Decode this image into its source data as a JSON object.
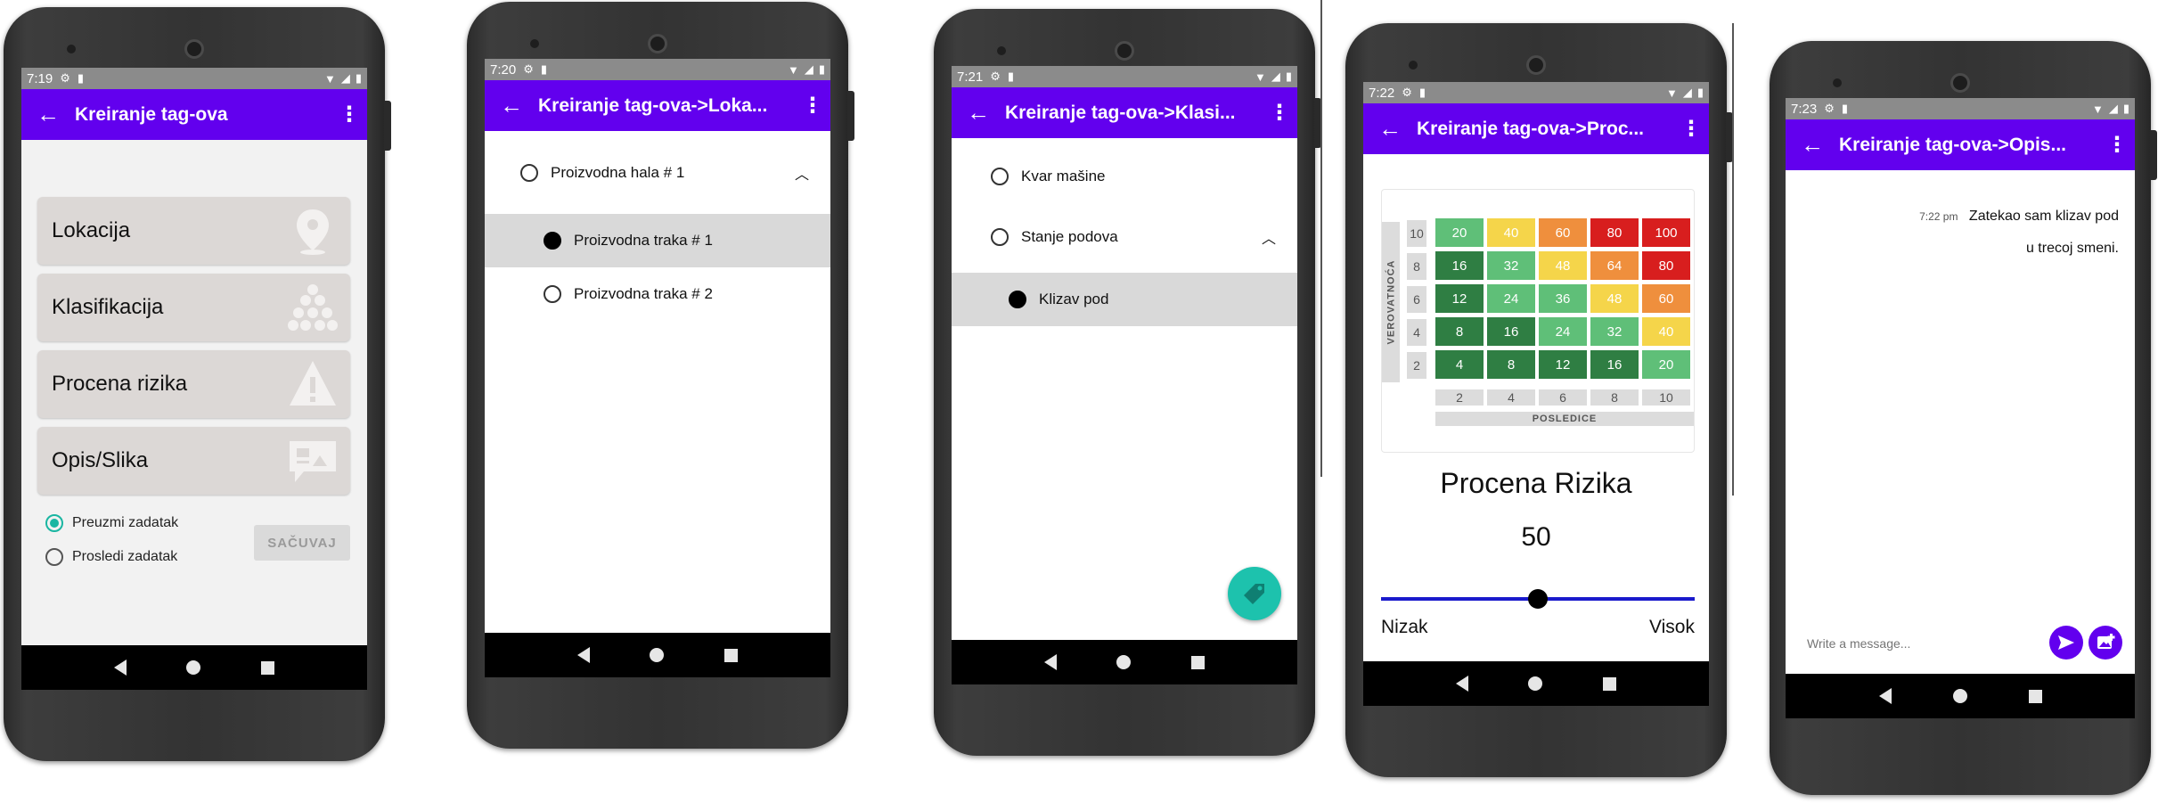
{
  "colors": {
    "app_bar": "#6200ee",
    "status_bar": "#8b8b8b",
    "accent_teal": "#1dc2ad",
    "slider": "#1a1acc"
  },
  "screens": [
    {
      "status_time": "7:19",
      "title": "Kreiranje tag-ova",
      "menu": [
        {
          "label": "Lokacija",
          "icon": "location-pin-icon"
        },
        {
          "label": "Klasifikacija",
          "icon": "hierarchy-icon"
        },
        {
          "label": "Procena rizika",
          "icon": "warning-icon"
        },
        {
          "label": "Opis/Slika",
          "icon": "image-message-icon"
        }
      ],
      "options": [
        {
          "label": "Preuzmi zadatak",
          "selected": true
        },
        {
          "label": "Prosledi zadatak",
          "selected": false
        }
      ],
      "save_label": "SAČUVAJ"
    },
    {
      "status_time": "7:20",
      "title": "Kreiranje tag-ova->Loka...",
      "tree": [
        {
          "label": "Proizvodna hala # 1",
          "level": 0,
          "selected": false,
          "expanded": true
        },
        {
          "label": "Proizvodna traka # 1",
          "level": 1,
          "selected": true
        },
        {
          "label": "Proizvodna traka # 2",
          "level": 1,
          "selected": false
        }
      ]
    },
    {
      "status_time": "7:21",
      "title": "Kreiranje tag-ova->Klasi...",
      "tree": [
        {
          "label": "Kvar mašine",
          "level": 0,
          "selected": false
        },
        {
          "label": "Stanje podova",
          "level": 0,
          "selected": false,
          "expanded": true
        },
        {
          "label": "Klizav pod",
          "level": 1,
          "selected": true
        }
      ],
      "fab_icon": "tag-icon"
    },
    {
      "status_time": "7:22",
      "title": "Kreiranje tag-ova->Proc...",
      "matrix": {
        "y_label": "VEROVATNOĆA",
        "x_label": "POSLEDICE",
        "y_ticks": [
          "10",
          "8",
          "6",
          "4",
          "2"
        ],
        "x_ticks": [
          "2",
          "4",
          "6",
          "8",
          "10"
        ],
        "rows": [
          [
            "20",
            "40",
            "60",
            "80",
            "100"
          ],
          [
            "16",
            "32",
            "48",
            "64",
            "80"
          ],
          [
            "12",
            "24",
            "36",
            "48",
            "60"
          ],
          [
            "8",
            "16",
            "24",
            "32",
            "40"
          ],
          [
            "4",
            "8",
            "12",
            "16",
            "20"
          ]
        ],
        "colors": [
          [
            "#5fbf78",
            "#f5d54a",
            "#ef8f3d",
            "#d81e1e",
            "#d81e1e"
          ],
          [
            "#2f7e43",
            "#5fbf78",
            "#f5d54a",
            "#ef8f3d",
            "#d81e1e"
          ],
          [
            "#2f7e43",
            "#5fbf78",
            "#5fbf78",
            "#f5d54a",
            "#ef8f3d"
          ],
          [
            "#2f7e43",
            "#2f7e43",
            "#5fbf78",
            "#5fbf78",
            "#f5d54a"
          ],
          [
            "#2f7e43",
            "#2f7e43",
            "#2f7e43",
            "#2f7e43",
            "#5fbf78"
          ]
        ]
      },
      "heading": "Procena Rizika",
      "value": "50",
      "slider_fraction": 0.5,
      "min_label": "Nizak",
      "max_label": "Visok"
    },
    {
      "status_time": "7:23",
      "title": "Kreiranje tag-ova->Opis...",
      "message": {
        "time": "7:22 pm",
        "line1": "Zatekao sam klizav pod",
        "line2": "u trecoj smeni."
      },
      "input_placeholder": "Write a message...",
      "send_icon": "send-icon",
      "attach_icon": "add-image-icon"
    }
  ]
}
